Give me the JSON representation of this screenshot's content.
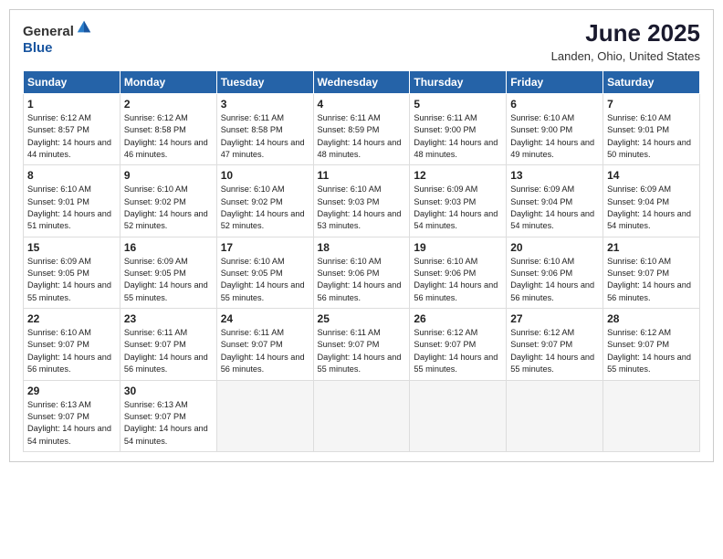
{
  "header": {
    "logo_general": "General",
    "logo_blue": "Blue",
    "month_year": "June 2025",
    "location": "Landen, Ohio, United States"
  },
  "weekdays": [
    "Sunday",
    "Monday",
    "Tuesday",
    "Wednesday",
    "Thursday",
    "Friday",
    "Saturday"
  ],
  "weeks": [
    [
      {
        "day": 1,
        "sunrise": "6:12 AM",
        "sunset": "8:57 PM",
        "daylight": "14 hours and 44 minutes."
      },
      {
        "day": 2,
        "sunrise": "6:12 AM",
        "sunset": "8:58 PM",
        "daylight": "14 hours and 46 minutes."
      },
      {
        "day": 3,
        "sunrise": "6:11 AM",
        "sunset": "8:58 PM",
        "daylight": "14 hours and 47 minutes."
      },
      {
        "day": 4,
        "sunrise": "6:11 AM",
        "sunset": "8:59 PM",
        "daylight": "14 hours and 48 minutes."
      },
      {
        "day": 5,
        "sunrise": "6:11 AM",
        "sunset": "9:00 PM",
        "daylight": "14 hours and 48 minutes."
      },
      {
        "day": 6,
        "sunrise": "6:10 AM",
        "sunset": "9:00 PM",
        "daylight": "14 hours and 49 minutes."
      },
      {
        "day": 7,
        "sunrise": "6:10 AM",
        "sunset": "9:01 PM",
        "daylight": "14 hours and 50 minutes."
      }
    ],
    [
      {
        "day": 8,
        "sunrise": "6:10 AM",
        "sunset": "9:01 PM",
        "daylight": "14 hours and 51 minutes."
      },
      {
        "day": 9,
        "sunrise": "6:10 AM",
        "sunset": "9:02 PM",
        "daylight": "14 hours and 52 minutes."
      },
      {
        "day": 10,
        "sunrise": "6:10 AM",
        "sunset": "9:02 PM",
        "daylight": "14 hours and 52 minutes."
      },
      {
        "day": 11,
        "sunrise": "6:10 AM",
        "sunset": "9:03 PM",
        "daylight": "14 hours and 53 minutes."
      },
      {
        "day": 12,
        "sunrise": "6:09 AM",
        "sunset": "9:03 PM",
        "daylight": "14 hours and 54 minutes."
      },
      {
        "day": 13,
        "sunrise": "6:09 AM",
        "sunset": "9:04 PM",
        "daylight": "14 hours and 54 minutes."
      },
      {
        "day": 14,
        "sunrise": "6:09 AM",
        "sunset": "9:04 PM",
        "daylight": "14 hours and 54 minutes."
      }
    ],
    [
      {
        "day": 15,
        "sunrise": "6:09 AM",
        "sunset": "9:05 PM",
        "daylight": "14 hours and 55 minutes."
      },
      {
        "day": 16,
        "sunrise": "6:09 AM",
        "sunset": "9:05 PM",
        "daylight": "14 hours and 55 minutes."
      },
      {
        "day": 17,
        "sunrise": "6:10 AM",
        "sunset": "9:05 PM",
        "daylight": "14 hours and 55 minutes."
      },
      {
        "day": 18,
        "sunrise": "6:10 AM",
        "sunset": "9:06 PM",
        "daylight": "14 hours and 56 minutes."
      },
      {
        "day": 19,
        "sunrise": "6:10 AM",
        "sunset": "9:06 PM",
        "daylight": "14 hours and 56 minutes."
      },
      {
        "day": 20,
        "sunrise": "6:10 AM",
        "sunset": "9:06 PM",
        "daylight": "14 hours and 56 minutes."
      },
      {
        "day": 21,
        "sunrise": "6:10 AM",
        "sunset": "9:07 PM",
        "daylight": "14 hours and 56 minutes."
      }
    ],
    [
      {
        "day": 22,
        "sunrise": "6:10 AM",
        "sunset": "9:07 PM",
        "daylight": "14 hours and 56 minutes."
      },
      {
        "day": 23,
        "sunrise": "6:11 AM",
        "sunset": "9:07 PM",
        "daylight": "14 hours and 56 minutes."
      },
      {
        "day": 24,
        "sunrise": "6:11 AM",
        "sunset": "9:07 PM",
        "daylight": "14 hours and 56 minutes."
      },
      {
        "day": 25,
        "sunrise": "6:11 AM",
        "sunset": "9:07 PM",
        "daylight": "14 hours and 55 minutes."
      },
      {
        "day": 26,
        "sunrise": "6:12 AM",
        "sunset": "9:07 PM",
        "daylight": "14 hours and 55 minutes."
      },
      {
        "day": 27,
        "sunrise": "6:12 AM",
        "sunset": "9:07 PM",
        "daylight": "14 hours and 55 minutes."
      },
      {
        "day": 28,
        "sunrise": "6:12 AM",
        "sunset": "9:07 PM",
        "daylight": "14 hours and 55 minutes."
      }
    ],
    [
      {
        "day": 29,
        "sunrise": "6:13 AM",
        "sunset": "9:07 PM",
        "daylight": "14 hours and 54 minutes."
      },
      {
        "day": 30,
        "sunrise": "6:13 AM",
        "sunset": "9:07 PM",
        "daylight": "14 hours and 54 minutes."
      },
      null,
      null,
      null,
      null,
      null
    ]
  ]
}
